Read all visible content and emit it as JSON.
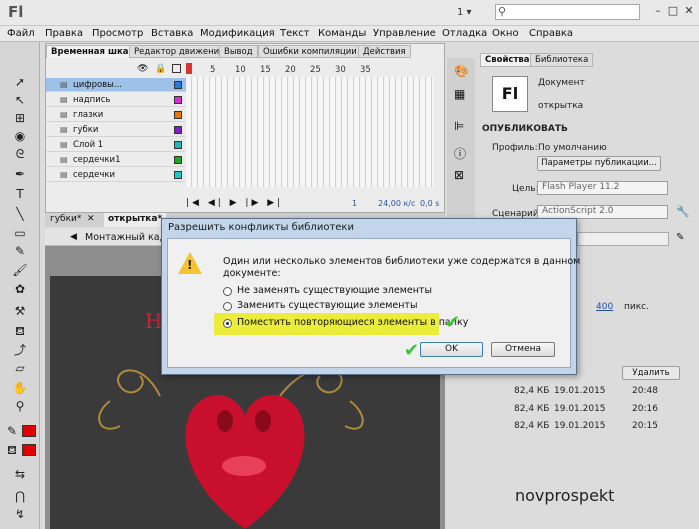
{
  "app": {
    "logo": "Fl",
    "workspace_number": "1 ▾",
    "search_placeholder": ""
  },
  "menu": [
    "Файл",
    "Правка",
    "Просмотр",
    "Вставка",
    "Модификация",
    "Текст",
    "Команды",
    "Управление",
    "Отладка",
    "Окно",
    "Справка"
  ],
  "timeline": {
    "tabs": [
      "Временная шкала",
      "Редактор движения",
      "Вывод",
      "Ошибки компиляции",
      "Действия"
    ],
    "frame_numbers": [
      "1",
      "5",
      "10",
      "15",
      "20",
      "25",
      "30",
      "35"
    ],
    "layers": [
      {
        "name": "цифровы...",
        "color": "#2a7bd6",
        "selected": true
      },
      {
        "name": "надпись",
        "color": "#d233d2"
      },
      {
        "name": "глазки",
        "color": "#e07a00"
      },
      {
        "name": "губки",
        "color": "#7a22c8"
      },
      {
        "name": "Слой 1",
        "color": "#22b8b8"
      },
      {
        "name": "сердечки1",
        "color": "#22a822"
      },
      {
        "name": "сердечки",
        "color": "#22c8c8"
      }
    ],
    "status": {
      "frame": "1",
      "fps": "24,00 к/с",
      "time": "0,0 s"
    }
  },
  "doc_tabs": [
    "губки*",
    "открытка*"
  ],
  "breadcrumb": "Монтажный кадр",
  "properties": {
    "tabs": [
      "Свойства",
      "Библиотека"
    ],
    "doc_type": "Документ",
    "doc_name": "открытка",
    "section_publish": "ОПУБЛИКОВАТЬ",
    "profile_label": "Профиль:",
    "profile_value": "По умолчанию",
    "publish_settings_button": "Параметры публикации...",
    "target_label": "Цель:",
    "target_value": "Flash Player 11.2",
    "script_label": "Сценарий:",
    "script_value": "ActionScript 2.0",
    "size_value": "400",
    "size_unit": "пикс.",
    "delete_button": "Удалить",
    "files": [
      {
        "size": "82,4 КБ",
        "date": "19.01.2015",
        "time": "20:48"
      },
      {
        "size": "82,4 КБ",
        "date": "19.01.2015",
        "time": "20:16"
      },
      {
        "size": "82,4 КБ",
        "date": "19.01.2015",
        "time": "20:15"
      }
    ],
    "logo": "Fl"
  },
  "dialog": {
    "title": "Разрешить конфликты библиотеки",
    "message_line1": "Один или несколько элементов библиотеки уже содержатся в данном",
    "message_line2": "документе:",
    "options": [
      "Не заменять существующие элементы",
      "Заменить существующие элементы",
      "Поместить повторяющиеся элементы в папку"
    ],
    "selected_option": 2,
    "ok": "OK",
    "cancel": "Отмена"
  },
  "watermark": "novprospekt",
  "colors": {
    "stroke": "#e00000",
    "fill": "#e00000",
    "highlight": "#ecec3a",
    "check": "#3ac43a"
  }
}
